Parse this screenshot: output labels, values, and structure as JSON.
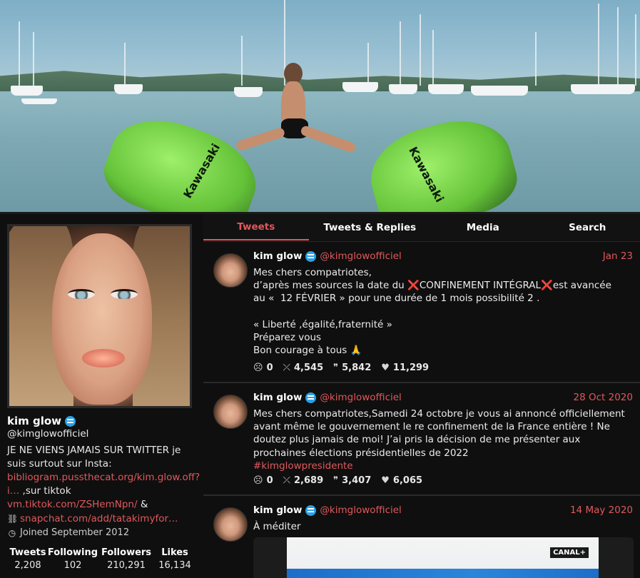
{
  "profile": {
    "name": "kim glow",
    "handle": "@kimglowofficiel",
    "bio": "JE NE VIENS JAMAIS SUR TWITTER je suis surtout sur Insta:",
    "link1": "bibliogram.pussthecat.org/kim.glow.off?i…",
    "link1_suffix": " ,sur tiktok",
    "link2": "vm.tiktok.com/ZSHemNpn/",
    "link2_suffix": " &",
    "link3": "snapchat.com/add/tatakimyfor…",
    "joined": "Joined September 2012",
    "stats": [
      {
        "label": "Tweets",
        "value": "2,208"
      },
      {
        "label": "Following",
        "value": "102"
      },
      {
        "label": "Followers",
        "value": "210,291"
      },
      {
        "label": "Likes",
        "value": "16,134"
      }
    ]
  },
  "tabs": [
    {
      "label": "Tweets",
      "active": true
    },
    {
      "label": "Tweets & Replies",
      "active": false
    },
    {
      "label": "Media",
      "active": false
    },
    {
      "label": "Search",
      "active": false
    }
  ],
  "tweets": [
    {
      "name": "kim glow",
      "handle": "@kimglowofficiel",
      "date": "Jan 23",
      "line1": "Mes chers compatriotes,",
      "line2a": "d’après mes sources la date du ",
      "x_mark": "❌",
      "line2b": "CONFINEMENT INTÉGRAL",
      "line2c": "est avancée",
      "line3": "au «  12 FÉVRIER » pour une durée de 1 mois possibilité 2 .",
      "line4": "",
      "line5": "« Liberté ,égalité,fraternité »",
      "line6": "Préparez vous",
      "line7": "Bon courage à tous 🙏",
      "replies": "0",
      "retweets": "4,545",
      "quotes": "5,842",
      "likes": "11,299"
    },
    {
      "name": "kim glow",
      "handle": "@kimglowofficiel",
      "date": "28 Oct 2020",
      "text": "Mes chers compatriotes,Samedi 24 octobre je vous ai annoncé officiellement avant même le gouvernement le re confinement de la France entière !  Ne doutez plus jamais de moi! J’ai pris la décision de me présenter aux prochaines élections présidentielles de 2022",
      "hashtag": "#kimglowpresidente",
      "replies": "0",
      "retweets": "2,689",
      "quotes": "3,407",
      "likes": "6,065"
    },
    {
      "name": "kim glow",
      "handle": "@kimglowofficiel",
      "date": "14 May 2020",
      "text": "À méditer",
      "media_badge": "CANAL+"
    }
  ],
  "icons": {
    "reply": "reply-icon",
    "retweet": "retweet-icon",
    "quote": "quote-icon",
    "like": "heart-icon",
    "verified": "verified-icon"
  },
  "colors": {
    "accent": "#e0585c",
    "verified": "#2ba1e6",
    "background": "#0f0f0f"
  }
}
